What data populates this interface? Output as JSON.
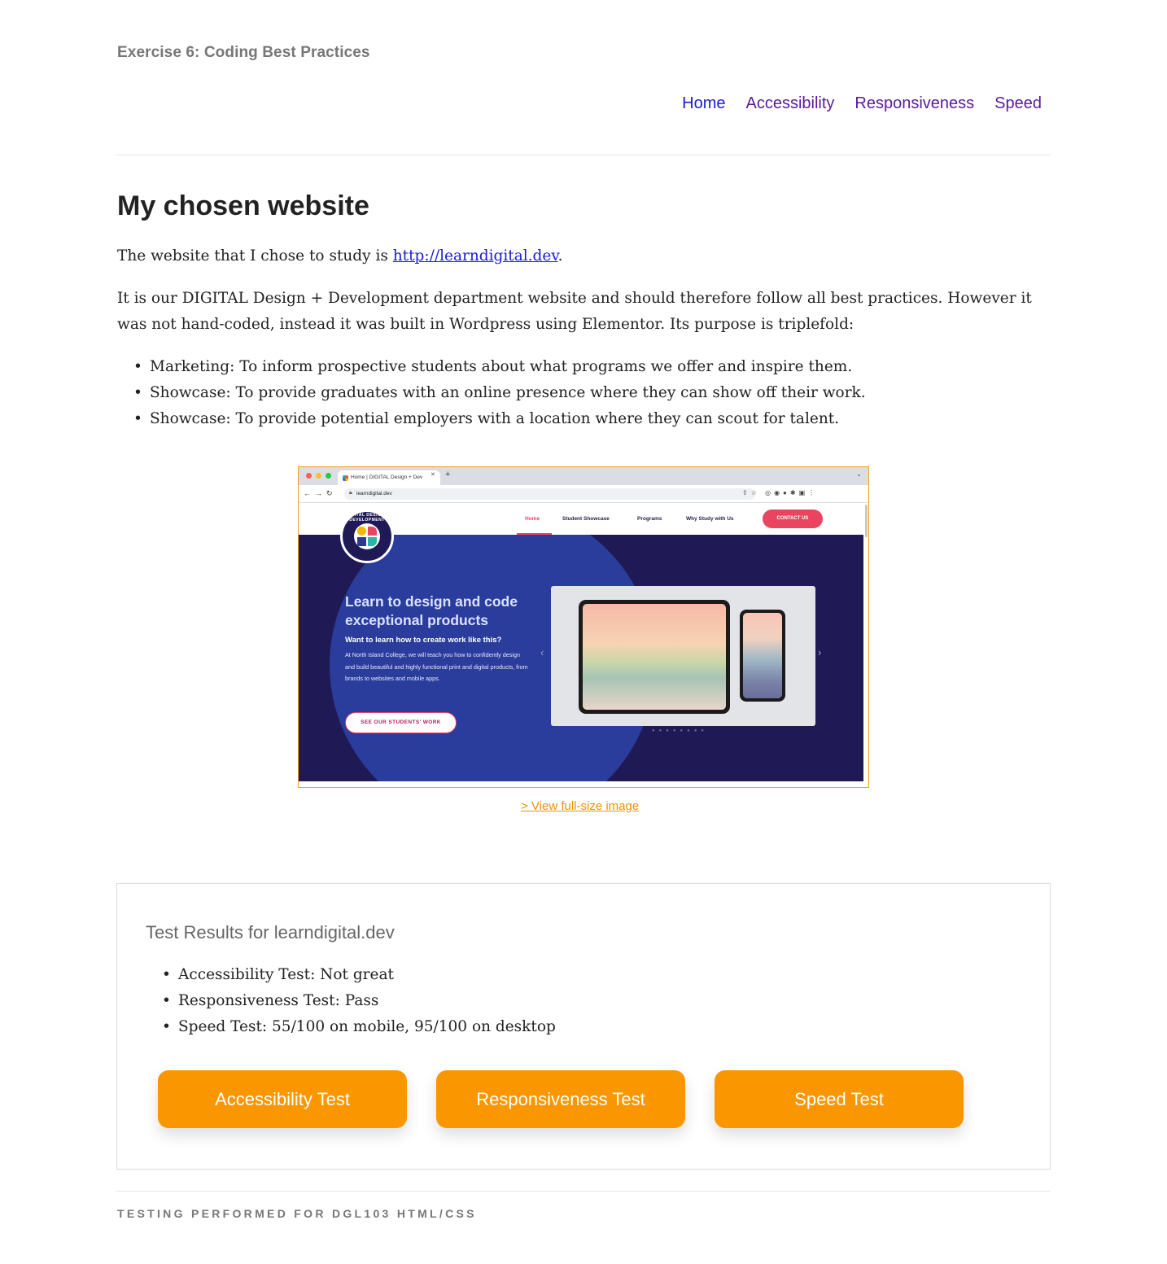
{
  "header": {
    "site_title": "Exercise 6: Coding Best Practices",
    "nav": [
      "Home",
      "Accessibility",
      "Responsiveness",
      "Speed"
    ]
  },
  "main": {
    "heading": "My chosen website",
    "intro_prefix": "The website that I chose to study is ",
    "intro_link": "http://learndigital.dev",
    "intro_suffix": ".",
    "description": "It is our DIGITAL Design + Development department website and should therefore follow all best practices. However it was not hand-coded, instead it was built in Wordpress using Elementor. Its purpose is triplefold:",
    "purposes": [
      "Marketing: To inform prospective students about what programs we offer and inspire them.",
      "Showcase: To provide graduates with an online presence where they can show off their work.",
      "Showcase: To provide potential employers with a location where they can scout for talent."
    ],
    "screenshot": {
      "tab_title": "Home | DIGITAL Design + Dev",
      "url": "learndigital.dev",
      "logo_text": "DIGITAL DESIGN • DEVELOPMENT",
      "nav": [
        "Home",
        "Student Showcase",
        "Programs",
        "Why Study with Us"
      ],
      "contact": "CONTACT US",
      "hero_heading": "Learn to design and code exceptional products",
      "hero_subheading": "Want to learn how to create work like this?",
      "hero_body": "At North Island College, we will teach you how to confidently design and build beautiful and highly functional print and digital products, from brands to websites and mobile apps.",
      "hero_button": "SEE OUR STUDENTS' WORK"
    },
    "view_link": "> View full-size image"
  },
  "results": {
    "title": "Test Results for learndigital.dev",
    "items": [
      "Accessibility Test: Not great",
      "Responsiveness Test: Pass",
      "Speed Test: 55/100 on mobile, 95/100 on desktop"
    ],
    "buttons": [
      "Accessibility Test",
      "Responsiveness Test",
      "Speed Test"
    ]
  },
  "footer": {
    "text": "TESTING PERFORMED FOR DGL103 HTML/CSS"
  },
  "colors": {
    "accent_orange": "#f99600",
    "link_blue": "#1a1adb",
    "visited_purple": "#5a1a9a",
    "hero_navy": "#1f1a55",
    "brand_pink": "#e94560"
  }
}
